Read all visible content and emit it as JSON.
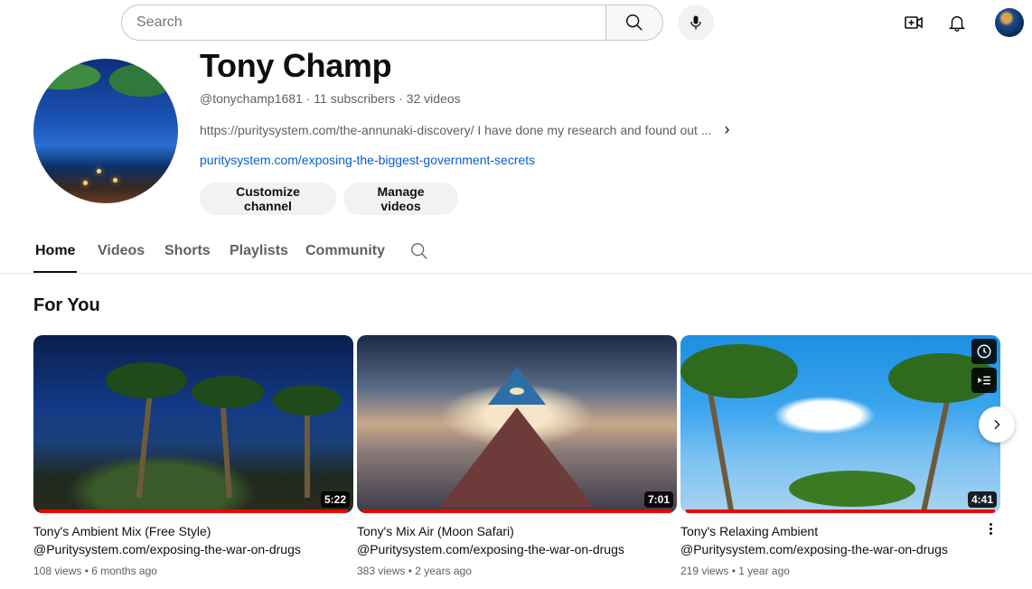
{
  "topbar": {
    "search_placeholder": "Search",
    "icons": [
      "search-icon",
      "microphone-icon",
      "create-video-icon",
      "notifications-bell-icon",
      "account-avatar"
    ]
  },
  "channel": {
    "name": "Tony Champ",
    "meta": "@tonychamp1681 · 11 subscribers · 32 videos",
    "description": "https://puritysystem.com/the-annunaki-discovery/ I have done my research and found out ...",
    "link": "puritysystem.com/exposing-the-biggest-government-secrets",
    "buttons": {
      "customize": "Customize channel",
      "manage": "Manage videos"
    }
  },
  "tabs": [
    {
      "label": "Home",
      "active": true
    },
    {
      "label": "Videos",
      "active": false
    },
    {
      "label": "Shorts",
      "active": false
    },
    {
      "label": "Playlists",
      "active": false
    },
    {
      "label": "Community",
      "active": false
    }
  ],
  "section": {
    "title": "For You"
  },
  "videos": [
    {
      "title": "Tony's Ambient Mix (Free Style)",
      "channel": "@Puritysystem.com/exposing-the-war-on-drugs",
      "meta": "108 views • 6 months ago",
      "duration": "5:22"
    },
    {
      "title": "Tony's Mix Air (Moon Safari)",
      "channel": "@Puritysystem.com/exposing-the-war-on-drugs",
      "meta": "383 views • 2 years ago",
      "duration": "7:01"
    },
    {
      "title": "Tony's Relaxing Ambient",
      "channel": "@Puritysystem.com/exposing-the-war-on-drugs",
      "meta": "219 views • 1 year ago",
      "duration": "4:41"
    }
  ],
  "colors": {
    "link": "#065fd4",
    "progress": "#ee0000",
    "text_secondary": "#606060"
  }
}
